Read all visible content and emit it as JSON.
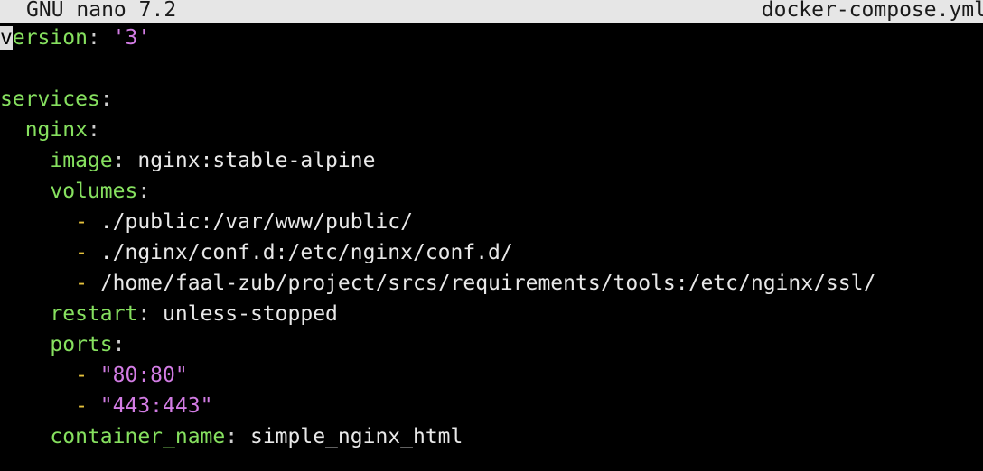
{
  "titlebar": {
    "app": "GNU nano 7.2",
    "file": "docker-compose.yml"
  },
  "lines": [
    {
      "indent": "",
      "cursor_char": "v",
      "key": "ersion",
      "sep": ": ",
      "str": "'3'"
    },
    {
      "blank": true
    },
    {
      "indent": "",
      "key": "services",
      "sep": ":"
    },
    {
      "indent": "  ",
      "key": "nginx",
      "sep": ":"
    },
    {
      "indent": "    ",
      "key": "image",
      "sep": ": ",
      "value": "nginx:stable-alpine"
    },
    {
      "indent": "    ",
      "key": "volumes",
      "sep": ":"
    },
    {
      "indent": "      ",
      "dash": "- ",
      "value": "./public:/var/www/public/"
    },
    {
      "indent": "      ",
      "dash": "- ",
      "value": "./nginx/conf.d:/etc/nginx/conf.d/"
    },
    {
      "indent": "      ",
      "dash": "- ",
      "value": "/home/faal-zub/project/srcs/requirements/tools:/etc/nginx/ssl/"
    },
    {
      "indent": "    ",
      "key": "restart",
      "sep": ": ",
      "value": "unless-stopped"
    },
    {
      "indent": "    ",
      "key": "ports",
      "sep": ":"
    },
    {
      "indent": "      ",
      "dash": "- ",
      "str": "\"80:80\""
    },
    {
      "indent": "      ",
      "dash": "- ",
      "str": "\"443:443\""
    },
    {
      "indent": "    ",
      "key": "container_name",
      "sep": ": ",
      "value": "simple_nginx_html"
    }
  ],
  "colors": {
    "key": "#86e05f",
    "string": "#d27ce4",
    "dash": "#e6c23c",
    "value": "#e8e8e8",
    "titlebar_bg": "#e6e6e6",
    "background": "#000000"
  }
}
